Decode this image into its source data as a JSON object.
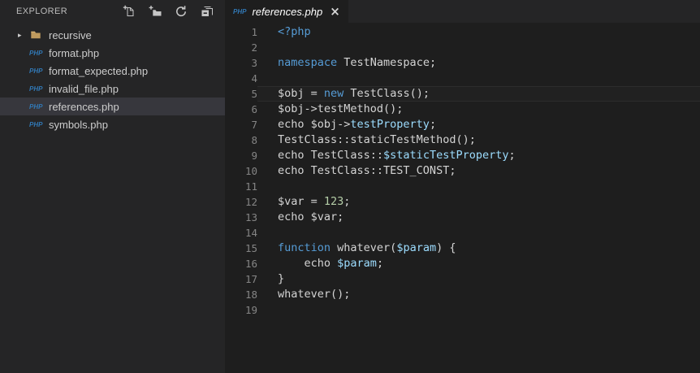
{
  "colors": {
    "editor_bg": "#1E1E1E",
    "sidebar_bg": "#252526",
    "tabstrip_bg": "#252526",
    "active_tab_bg": "#1E1E1E",
    "selected_row_bg": "#37373D",
    "keyword": "#569CD6",
    "variable": "#9CDCFE",
    "number": "#B5CEA8",
    "code_default": "#D4D4D4",
    "line_number": "#858585",
    "ui_text": "#CCCCCC",
    "php_icon_blue": "#3178B5",
    "folder_tan": "#C09B5E",
    "icon_gray": "#C5C5C5",
    "active_line_border": "#2D2D2D"
  },
  "icons": {
    "php_label": "PHP",
    "chevron_collapsed": "▸",
    "close_glyph": "×",
    "header_actions": [
      "new-file-icon",
      "new-folder-icon",
      "refresh-icon",
      "collapse-all-icon"
    ]
  },
  "sidebar": {
    "header": {
      "title": "EXPLORER"
    },
    "files": [
      {
        "label": "recursive",
        "type": "folder",
        "expanded": false,
        "selected": false
      },
      {
        "label": "format.php",
        "type": "php-file",
        "selected": false
      },
      {
        "label": "format_expected.php",
        "type": "php-file",
        "selected": false
      },
      {
        "label": "invalid_file.php",
        "type": "php-file",
        "selected": false
      },
      {
        "label": "references.php",
        "type": "php-file",
        "selected": true
      },
      {
        "label": "symbols.php",
        "type": "php-file",
        "selected": false
      }
    ]
  },
  "editor": {
    "tab": {
      "title": "references.php",
      "icon": "php",
      "preview_italic": true
    },
    "active_line": 5,
    "lines": [
      {
        "num": 1,
        "tokens": [
          [
            "k",
            "<?php"
          ]
        ]
      },
      {
        "num": 2,
        "tokens": []
      },
      {
        "num": 3,
        "tokens": [
          [
            "k",
            "namespace"
          ],
          [
            "d",
            " TestNamespace;"
          ]
        ]
      },
      {
        "num": 4,
        "tokens": []
      },
      {
        "num": 5,
        "tokens": [
          [
            "d",
            "$obj = "
          ],
          [
            "k",
            "new"
          ],
          [
            "d",
            " TestClass();"
          ]
        ]
      },
      {
        "num": 6,
        "tokens": [
          [
            "d",
            "$obj->testMethod();"
          ]
        ]
      },
      {
        "num": 7,
        "tokens": [
          [
            "d",
            "echo $obj->"
          ],
          [
            "v",
            "testProperty"
          ],
          [
            "d",
            ";"
          ]
        ]
      },
      {
        "num": 8,
        "tokens": [
          [
            "d",
            "TestClass::staticTestMethod();"
          ]
        ]
      },
      {
        "num": 9,
        "tokens": [
          [
            "d",
            "echo TestClass::"
          ],
          [
            "v",
            "$staticTestProperty"
          ],
          [
            "d",
            ";"
          ]
        ]
      },
      {
        "num": 10,
        "tokens": [
          [
            "d",
            "echo TestClass::TEST_CONST;"
          ]
        ]
      },
      {
        "num": 11,
        "tokens": []
      },
      {
        "num": 12,
        "tokens": [
          [
            "d",
            "$var = "
          ],
          [
            "n",
            "123"
          ],
          [
            "d",
            ";"
          ]
        ]
      },
      {
        "num": 13,
        "tokens": [
          [
            "d",
            "echo $var;"
          ]
        ]
      },
      {
        "num": 14,
        "tokens": []
      },
      {
        "num": 15,
        "tokens": [
          [
            "k",
            "function"
          ],
          [
            "d",
            " whatever("
          ],
          [
            "v",
            "$param"
          ],
          [
            "d",
            ") {"
          ]
        ]
      },
      {
        "num": 16,
        "tokens": [
          [
            "d",
            "    echo "
          ],
          [
            "v",
            "$param"
          ],
          [
            "d",
            ";"
          ]
        ]
      },
      {
        "num": 17,
        "tokens": [
          [
            "d",
            "}"
          ]
        ]
      },
      {
        "num": 18,
        "tokens": [
          [
            "d",
            "whatever();"
          ]
        ]
      },
      {
        "num": 19,
        "tokens": []
      }
    ]
  }
}
